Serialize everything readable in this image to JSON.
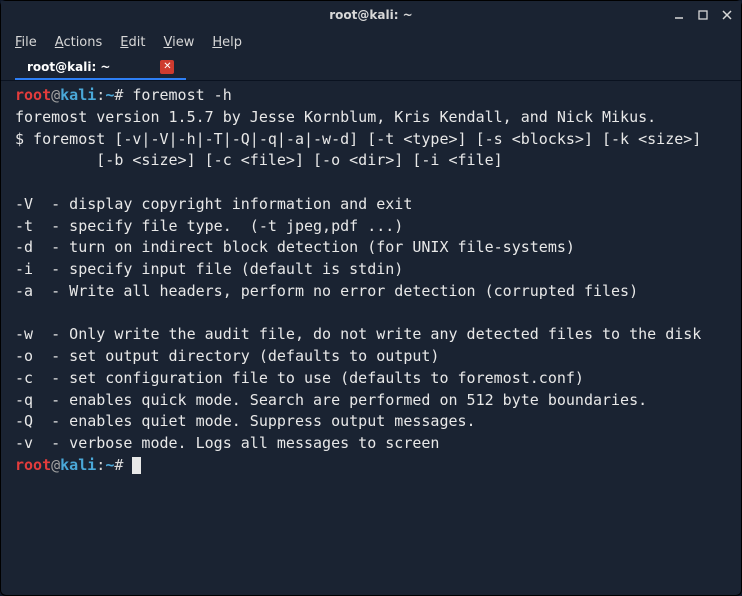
{
  "titlebar": {
    "title": "root@kali: ~"
  },
  "menubar": {
    "file": "File",
    "actions": "Actions",
    "edit": "Edit",
    "view": "View",
    "help": "Help"
  },
  "tab": {
    "label": "root@kali: ~"
  },
  "prompt": {
    "user": "root",
    "at": "@",
    "host": "kali",
    "colon": ":",
    "path": "~",
    "hash": "#"
  },
  "session": {
    "cmd1": " foremost -h",
    "out1": "foremost version 1.5.7 by Jesse Kornblum, Kris Kendall, and Nick Mikus.",
    "out2": "$ foremost [-v|-V|-h|-T|-Q|-q|-a|-w-d] [-t <type>] [-s <blocks>] [-k <size>]",
    "out3": "         [-b <size>] [-c <file>] [-o <dir>] [-i <file]",
    "out4": "",
    "out5": "-V  - display copyright information and exit",
    "out6": "-t  - specify file type.  (-t jpeg,pdf ...)",
    "out7": "-d  - turn on indirect block detection (for UNIX file-systems)",
    "out8": "-i  - specify input file (default is stdin)",
    "out9": "-a  - Write all headers, perform no error detection (corrupted files)",
    "out10": "",
    "out11": "-w  - Only write the audit file, do not write any detected files to the disk",
    "out12": "-o  - set output directory (defaults to output)",
    "out13": "-c  - set configuration file to use (defaults to foremost.conf)",
    "out14": "-q  - enables quick mode. Search are performed on 512 byte boundaries.",
    "out15": "-Q  - enables quiet mode. Suppress output messages.",
    "out16": "-v  - verbose mode. Logs all messages to screen"
  }
}
